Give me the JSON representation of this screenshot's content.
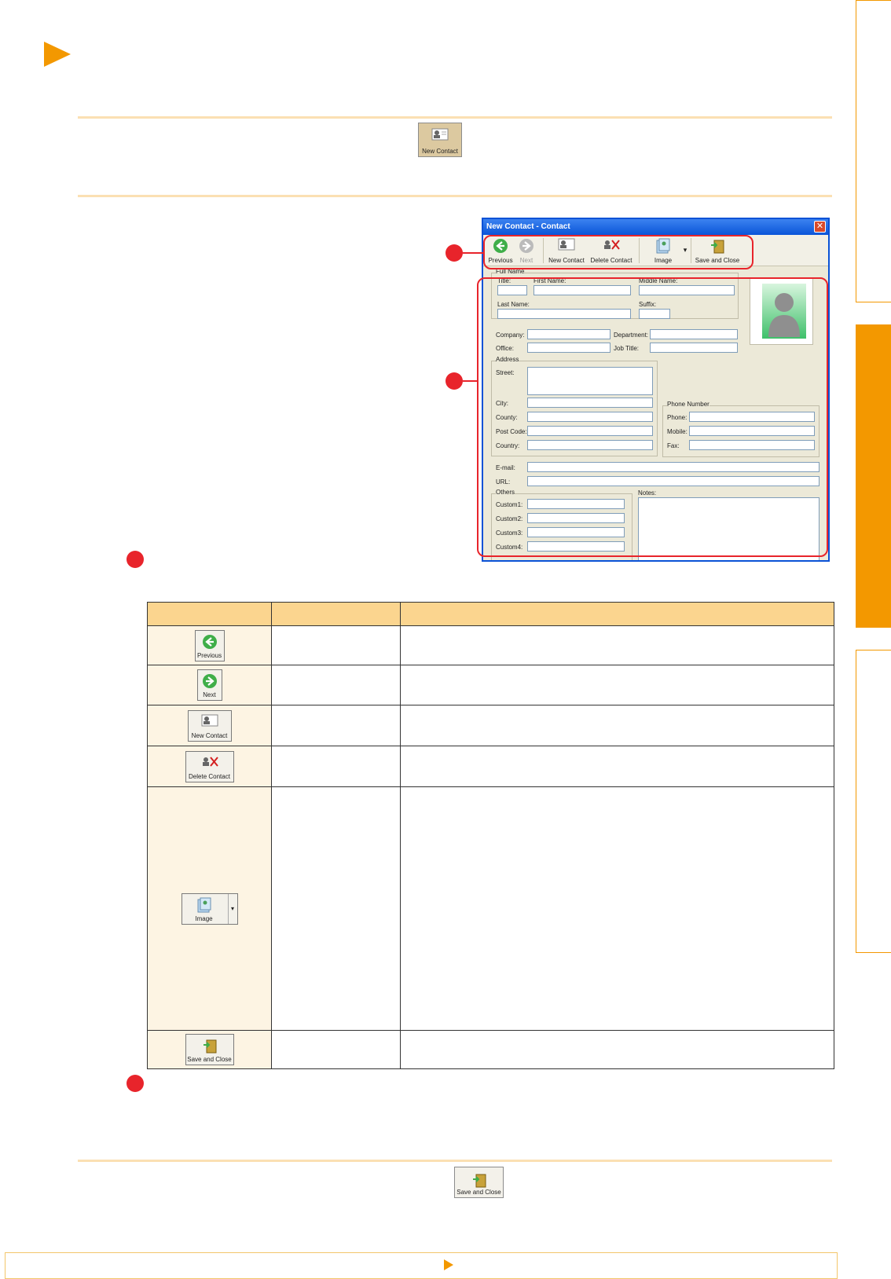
{
  "toolbar_labels": {
    "previous": "Previous",
    "next": "Next",
    "new_contact": "New Contact",
    "delete_contact": "Delete Contact",
    "image": "Image",
    "save_and_close": "Save and Close"
  },
  "dialog": {
    "title": "New Contact - Contact",
    "close_glyph": "✕",
    "dropdown_glyph": "▾",
    "labels": {
      "full_name": "Full Name",
      "title": "Title:",
      "first_name": "First Name:",
      "middle_name": "Middle Name:",
      "last_name": "Last Name:",
      "suffix": "Suffix:",
      "company": "Company:",
      "department": "Department:",
      "office": "Office:",
      "job_title": "Job Title:",
      "address": "Address",
      "street": "Street:",
      "city": "City:",
      "county": "County:",
      "post_code": "Post Code:",
      "country": "Country:",
      "phone_number": "Phone Number",
      "phone": "Phone:",
      "mobile": "Mobile:",
      "fax": "Fax:",
      "email": "E-mail:",
      "url": "URL:",
      "others": "Others",
      "custom1": "Custom1:",
      "custom2": "Custom2:",
      "custom3": "Custom3:",
      "custom4": "Custom4:",
      "notes": "Notes:"
    }
  },
  "table": {
    "rows": [
      "previous",
      "next",
      "new_contact",
      "delete_contact",
      "image",
      "save_and_close"
    ]
  },
  "colors": {
    "accent": "#f39800",
    "callout": "#e8242b",
    "header_fill": "#fbd58f",
    "icon_cell_fill": "#fdf4e3"
  }
}
